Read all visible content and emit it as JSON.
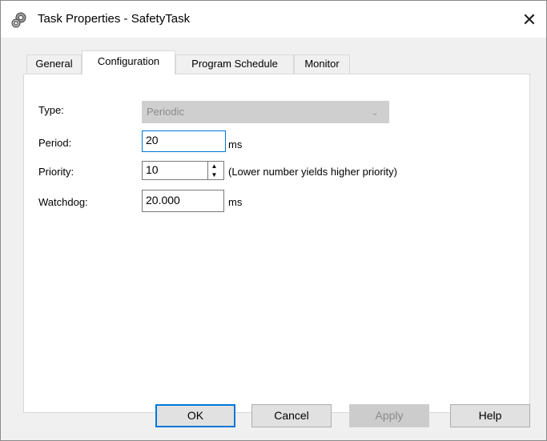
{
  "window": {
    "title": "Task Properties - SafetyTask",
    "close_glyph": "✕",
    "icon": "gear-icon"
  },
  "tabs": [
    {
      "label": "General",
      "active": false
    },
    {
      "label": "Configuration",
      "active": true
    },
    {
      "label": "Program Schedule",
      "active": false
    },
    {
      "label": "Monitor",
      "active": false
    }
  ],
  "form": {
    "type_label": "Type:",
    "type_value": "Periodic",
    "period_label": "Period:",
    "period_value": "20",
    "period_unit": "ms",
    "priority_label": "Priority:",
    "priority_value": "10",
    "priority_hint": "(Lower number yields higher priority)",
    "watchdog_label": "Watchdog:",
    "watchdog_value": "20.000",
    "watchdog_unit": "ms"
  },
  "buttons": {
    "ok": "OK",
    "cancel": "Cancel",
    "apply": "Apply",
    "help": "Help"
  },
  "colors": {
    "focus_accent": "#0078d7",
    "disabled_fill": "#cfcfcf"
  }
}
